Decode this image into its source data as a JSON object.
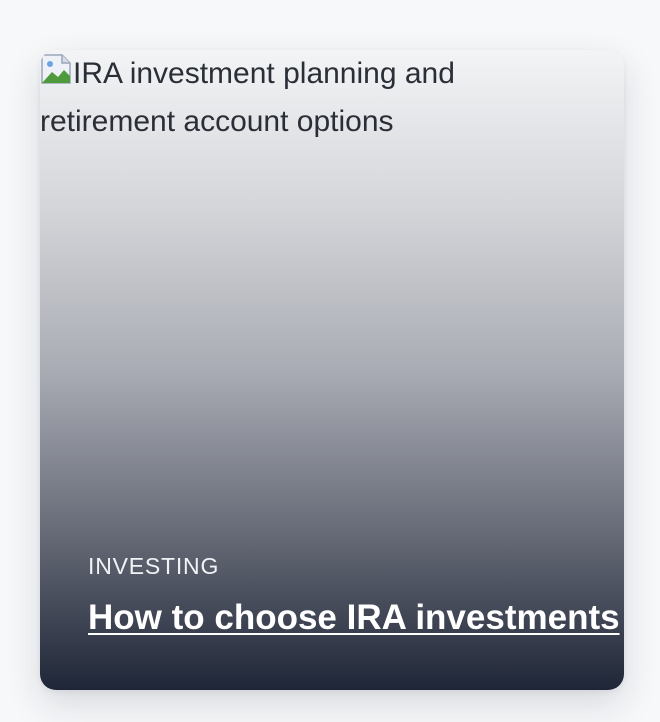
{
  "article_card": {
    "image_alt": "IRA investment planning and retirement account options",
    "category": "INVESTING",
    "title": "How to choose IRA investments"
  },
  "icons": {
    "image_placeholder": "broken-image-icon"
  }
}
